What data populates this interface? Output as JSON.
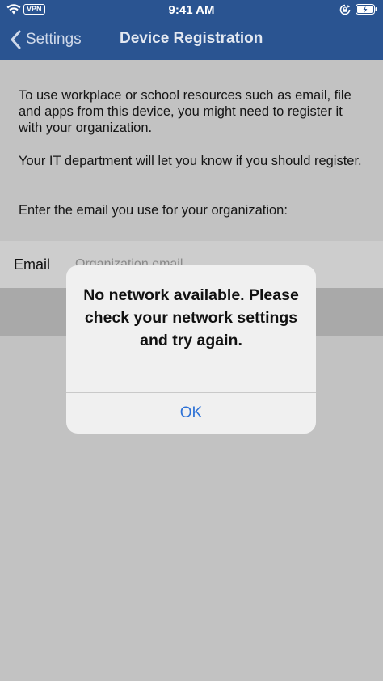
{
  "status_bar": {
    "time": "9:41 AM",
    "vpn": "VPN",
    "icons": [
      "wifi-icon",
      "rotation-lock-icon",
      "battery-icon"
    ]
  },
  "nav": {
    "back_label": "Settings",
    "title": "Device Registration"
  },
  "content": {
    "paragraph1": "To use workplace or school resources such as email, file and apps from this device, you might need to register it with your organization.",
    "paragraph2": "Your IT department will let you know if you should register.",
    "paragraph3": "Enter the email you use for your organization:"
  },
  "email": {
    "label": "Email",
    "placeholder": "Organization email",
    "value": ""
  },
  "alert": {
    "message": "No network available. Please check your network settings and try again.",
    "ok_label": "OK"
  },
  "colors": {
    "header_bg": "#2a5491",
    "page_bg": "#c2c2c2",
    "alert_bg": "#f0f0f0",
    "accent": "#2e72d6"
  }
}
